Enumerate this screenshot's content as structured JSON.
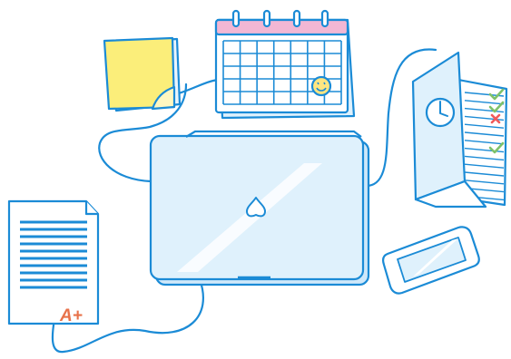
{
  "illustration": {
    "items": [
      "sticky-notes",
      "calendar",
      "laptop",
      "document",
      "checklist-folder",
      "smartphone"
    ],
    "document": {
      "grade": "A+"
    },
    "laptop": {
      "logo": "heart-drop"
    },
    "calendar": {
      "sticker": "smiley"
    },
    "checklist": {
      "marks": [
        "check",
        "check",
        "cross",
        "check"
      ]
    }
  },
  "colors": {
    "outline": "#1b8bd6",
    "fill": "#dff1fc",
    "sticky": "#fbee7a",
    "calendar_header": "#f2b7d4",
    "smiley": "#ffe680",
    "check": "#7ec26a",
    "cross": "#f05a5a",
    "grade": "#e8724a"
  }
}
